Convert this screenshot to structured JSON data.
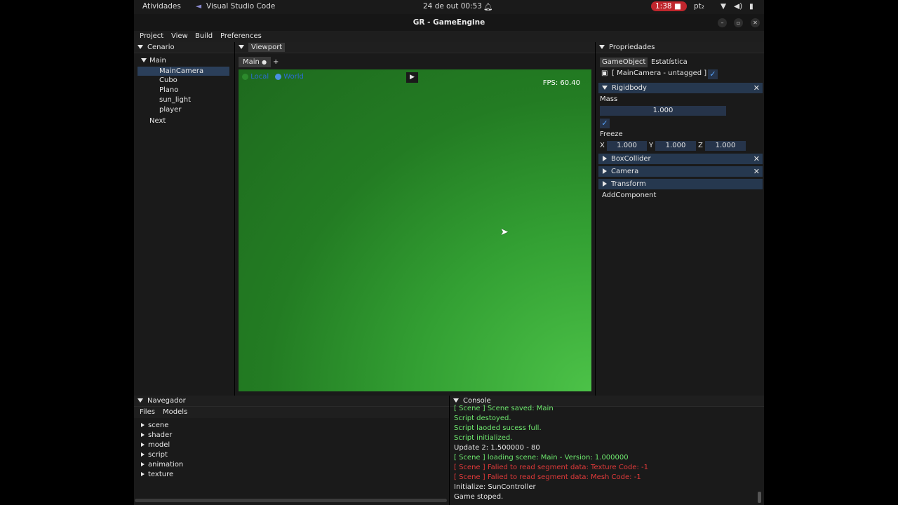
{
  "system_bar": {
    "activities": "Atividades",
    "app_name": "Visual Studio Code",
    "datetime": "24 de out  00:53",
    "recording_time": "1:38",
    "lang": "pt₂"
  },
  "window": {
    "title": "GR - GameEngine"
  },
  "menu": [
    "Project",
    "View",
    "Build",
    "Preferences"
  ],
  "scene_panel": {
    "title": "Cenario",
    "root": "Main",
    "children": [
      "MainCamera",
      "Cubo",
      "Plano",
      "sun_light",
      "player"
    ],
    "selected": "MainCamera",
    "next": "Next"
  },
  "viewport": {
    "title": "Viewport",
    "tab": "Main",
    "add_tab": "+",
    "local_label": "Local",
    "world_label": "World",
    "fps": "FPS: 60.40"
  },
  "properties": {
    "title": "Propriedades",
    "tabs": [
      "GameObject",
      "Estatística"
    ],
    "object_label": "[ MainCamera - untagged ]",
    "rigidbody": {
      "title": "Rigidbody",
      "mass_label": "Mass",
      "mass_value": "1.000",
      "freeze_label": "Freeze",
      "x_label": "X",
      "x_value": "1.000",
      "y_label": "Y",
      "y_value": "1.000",
      "z_label": "Z",
      "z_value": "1.000"
    },
    "components": [
      "BoxCollider",
      "Camera",
      "Transform"
    ],
    "add_component": "AddComponent"
  },
  "navigator": {
    "title": "Navegador",
    "tabs": [
      "Files",
      "Models"
    ],
    "items": [
      "scene",
      "shader",
      "model",
      "script",
      "animation",
      "texture"
    ]
  },
  "console": {
    "title": "Console",
    "lines": [
      {
        "text": "[ Scene ] Scene saved: Main",
        "color": "#6ee86e"
      },
      {
        "text": "Script destoyed.",
        "color": "#6ee86e"
      },
      {
        "text": "Script laoded sucess full.",
        "color": "#6ee86e"
      },
      {
        "text": "Script initialized.",
        "color": "#6ee86e"
      },
      {
        "text": "Update 2: 1.500000 - 80",
        "color": "#e6e6e6"
      },
      {
        "text": "[ Scene ] loading scene: Main - Version: 1.000000",
        "color": "#6ee86e"
      },
      {
        "text": "[ Scene ] Falied to read segment data: Texture Code: -1",
        "color": "#e23a3a"
      },
      {
        "text": "[ Scene ] Falied to read segment data: Mesh Code: -1",
        "color": "#e23a3a"
      },
      {
        "text": "Initialize: SunController",
        "color": "#e6e6e6"
      },
      {
        "text": "Game stoped.",
        "color": "#e6e6e6"
      }
    ]
  },
  "colors": {
    "accent": "#26384f",
    "viewport_green": "#2f8f2f",
    "record_red": "#c0262d"
  }
}
